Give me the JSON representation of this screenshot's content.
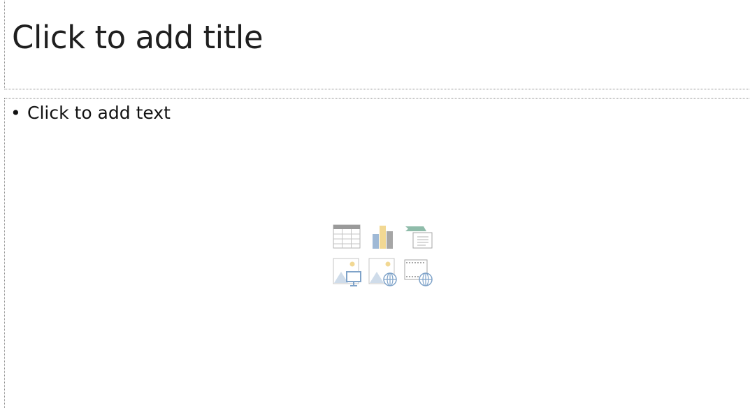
{
  "slide": {
    "title_placeholder": "Click to add title",
    "body_bullet": "•",
    "body_placeholder": "Click to add text"
  },
  "content_icons": [
    {
      "name": "insert-table-icon"
    },
    {
      "name": "insert-chart-icon"
    },
    {
      "name": "insert-smartart-icon"
    },
    {
      "name": "insert-picture-icon"
    },
    {
      "name": "insert-online-picture-icon"
    },
    {
      "name": "insert-video-icon"
    }
  ],
  "colors": {
    "placeholder_border": "#8c8c8c",
    "icon_gray": "#a6a6a6",
    "icon_blue": "#9fb9d6",
    "icon_yellow": "#f2d893",
    "icon_green": "#8fbcaa"
  }
}
